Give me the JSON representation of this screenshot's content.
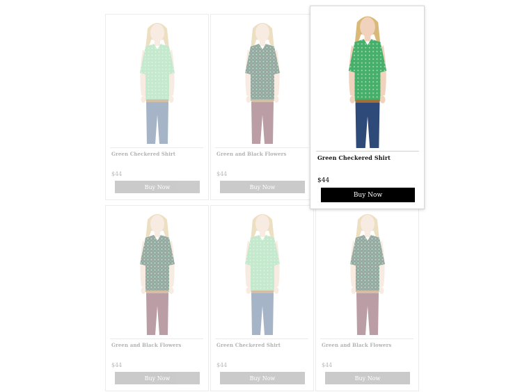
{
  "products": [
    {
      "name": "Green Checkered Shirt",
      "price": "$44",
      "button": "Buy Now",
      "shirt": "#7fd08f",
      "shirt_pattern": "check",
      "pants": "#3b5b86",
      "state": "faded"
    },
    {
      "name": "Green and Black Flowers",
      "price": "$44",
      "button": "Buy Now",
      "shirt": "#1f3a2f",
      "shirt_pattern": "flower",
      "pants": "#6b2a3a",
      "state": "faded"
    },
    {
      "name": "Green Checkered Shirt",
      "price": "$44",
      "button": "Buy Now",
      "shirt": "#46b06a",
      "shirt_pattern": "check",
      "pants": "#2e4a78",
      "state": "active"
    },
    {
      "name": "Green and Black Flowers",
      "price": "$44",
      "button": "Buy Now",
      "shirt": "#1f3a2f",
      "shirt_pattern": "flower",
      "pants": "#6b2a3a",
      "state": "faded"
    },
    {
      "name": "Green Checkered Shirt",
      "price": "$44",
      "button": "Buy Now",
      "shirt": "#7fd08f",
      "shirt_pattern": "check",
      "pants": "#3b5b86",
      "state": "faded"
    },
    {
      "name": "Green and Black Flowers",
      "price": "$44",
      "button": "Buy Now",
      "shirt": "#1f3a2f",
      "shirt_pattern": "flower",
      "pants": "#6b2a3a",
      "state": "faded"
    }
  ]
}
